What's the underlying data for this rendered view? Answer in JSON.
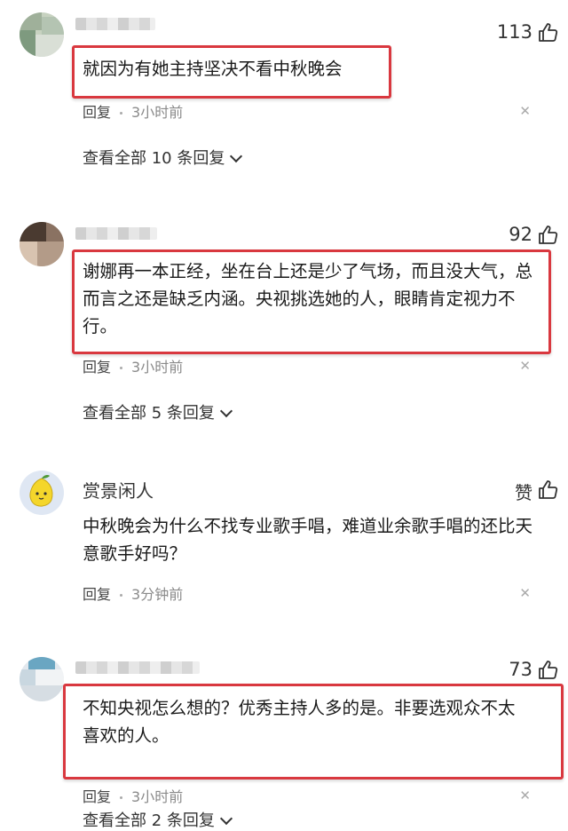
{
  "comments": [
    {
      "likes": "113",
      "text": "就因为有她主持坚决不看中秋晚会",
      "reply_label": "回复",
      "time": "3小时前",
      "view_all": "查看全部 10 条回复"
    },
    {
      "likes": "92",
      "text": "谢娜再一本正经，坐在台上还是少了气场，而且没大气，总而言之还是缺乏内涵。央视挑选她的人，眼睛肯定视力不行。",
      "reply_label": "回复",
      "time": "3小时前",
      "view_all": "查看全部 5 条回复"
    },
    {
      "username": "赏景闲人",
      "likes": "赞",
      "text": "中秋晚会为什么不找专业歌手唱，难道业余歌手唱的还比天意歌手好吗？",
      "reply_label": "回复",
      "time": "3分钟前"
    },
    {
      "likes": "73",
      "text": "不知央视怎么想的？优秀主持人多的是。非要选观众不太喜欢的人。",
      "reply_label": "回复",
      "time": "3小时前",
      "view_all": "查看全部 2 条回复"
    }
  ],
  "icons": {
    "thumb": "thumbs-up-icon",
    "close": "close-icon",
    "chevron": "chevron-down-icon"
  },
  "colors": {
    "highlight_box": "#d9383f"
  }
}
